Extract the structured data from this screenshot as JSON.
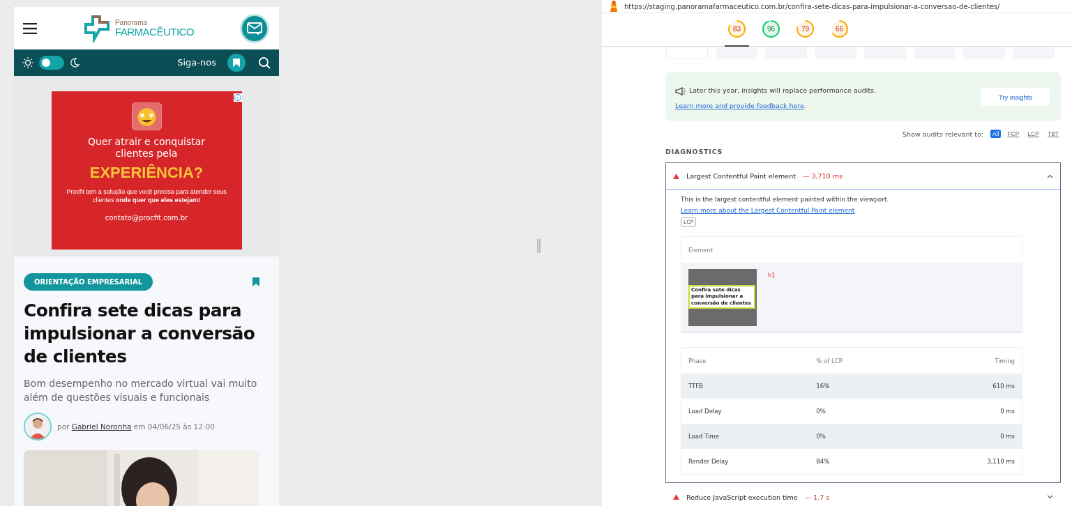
{
  "mobile": {
    "header": {
      "logo_top": "Panorama",
      "logo_bottom": "FARMACÊUTICO"
    },
    "toolbar": {
      "dark_mode": false,
      "follow_label": "Siga-nos"
    },
    "ad": {
      "headline": "Quer atrair e conquistar clientes pela",
      "highlight": "EXPERIÊNCIA?",
      "body": "Procfit tem a solução que você precisa para atender seus clientes **onde quer que eles estejam!**",
      "contact": "contato@procfit.com.br"
    },
    "article": {
      "category": "ORIENTAÇÃO EMPRESARIAL",
      "title": "Confira sete dicas para impulsionar a conversão de clientes",
      "subtitle": "Bom desempenho no mercado virtual vai muito além de questões visuais e funcionais",
      "byline_prefix": "por",
      "author": "Gabriel Noronha",
      "byline_suffix": "em 04/06/25 às 12:00"
    }
  },
  "report": {
    "url": "https://staging.panoramafarmaceutico.com.br/confira-sete-dicas-para-impulsionar-a-conversao-de-clientes/",
    "scores": [
      {
        "value": "83",
        "kind": "average",
        "selected": true
      },
      {
        "value": "96",
        "kind": "pass",
        "selected": false
      },
      {
        "value": "79",
        "kind": "average",
        "selected": false
      },
      {
        "value": "66",
        "kind": "average",
        "selected": false
      }
    ],
    "notice": {
      "text": "Later this year, insights will replace performance audits.",
      "link": "Learn more and provide feedback here",
      "end": ".",
      "button": "Try insights"
    },
    "filter": {
      "label": "Show audits relevant to:",
      "options": [
        {
          "label": "All",
          "selected": true
        },
        {
          "label": "FCP",
          "selected": false
        },
        {
          "label": "LCP",
          "selected": false
        },
        {
          "label": "TBT",
          "selected": false
        }
      ]
    },
    "section_title": "DIAGNOSTICS",
    "audits": [
      {
        "title": "Largest Contentful Paint element",
        "value": "— 3,710 ms",
        "expanded": true,
        "description": "This is the largest contentful element painted within the viewport.",
        "link": "Learn more about the Largest Contentful Paint element",
        "tag": "LCP",
        "element": {
          "header": "Element",
          "thumbnail_text": "Confira sete dicas para impulsionar a conversão de clientes",
          "selector": "h1"
        },
        "phases": {
          "columns": [
            "Phase",
            "% of LCP",
            "Timing"
          ],
          "rows": [
            [
              "TTFB",
              "16%",
              "610 ms"
            ],
            [
              "Load Delay",
              "0%",
              "0 ms"
            ],
            [
              "Load Time",
              "0%",
              "0 ms"
            ],
            [
              "Render Delay",
              "84%",
              "3,110 ms"
            ]
          ]
        }
      },
      {
        "title": "Reduce JavaScript execution time",
        "value": "— 1.7 s",
        "expanded": false
      }
    ]
  }
}
